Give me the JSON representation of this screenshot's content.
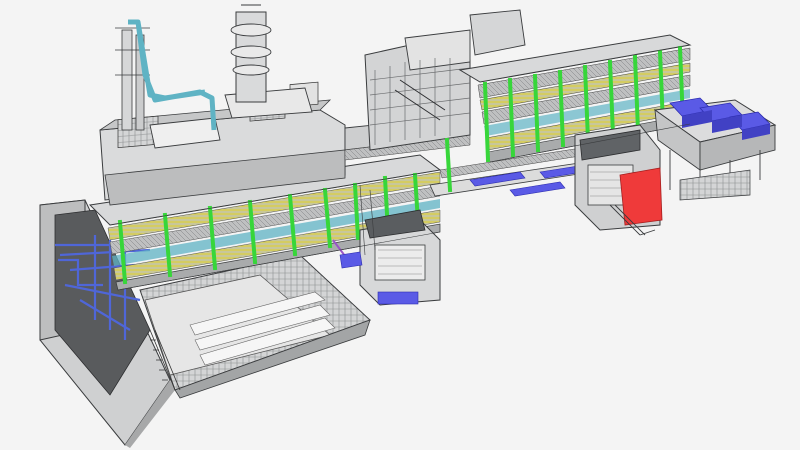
{
  "scene": {
    "background": "#f4f4f4",
    "colors": {
      "steel_light": "#d9dadb",
      "steel_mid": "#b9babb",
      "steel_dark": "#7c7e80",
      "edge": "#3a3c3e",
      "column_green": "#37d63a",
      "cable_yellow": "#d9cf4a",
      "pipe_teal": "#5fb3c4",
      "equipment_blue": "#5a5ae6",
      "pipe_blue": "#4f66d8",
      "equipment_red": "#ef3a3a",
      "accent_purple": "#9a55c8"
    }
  }
}
